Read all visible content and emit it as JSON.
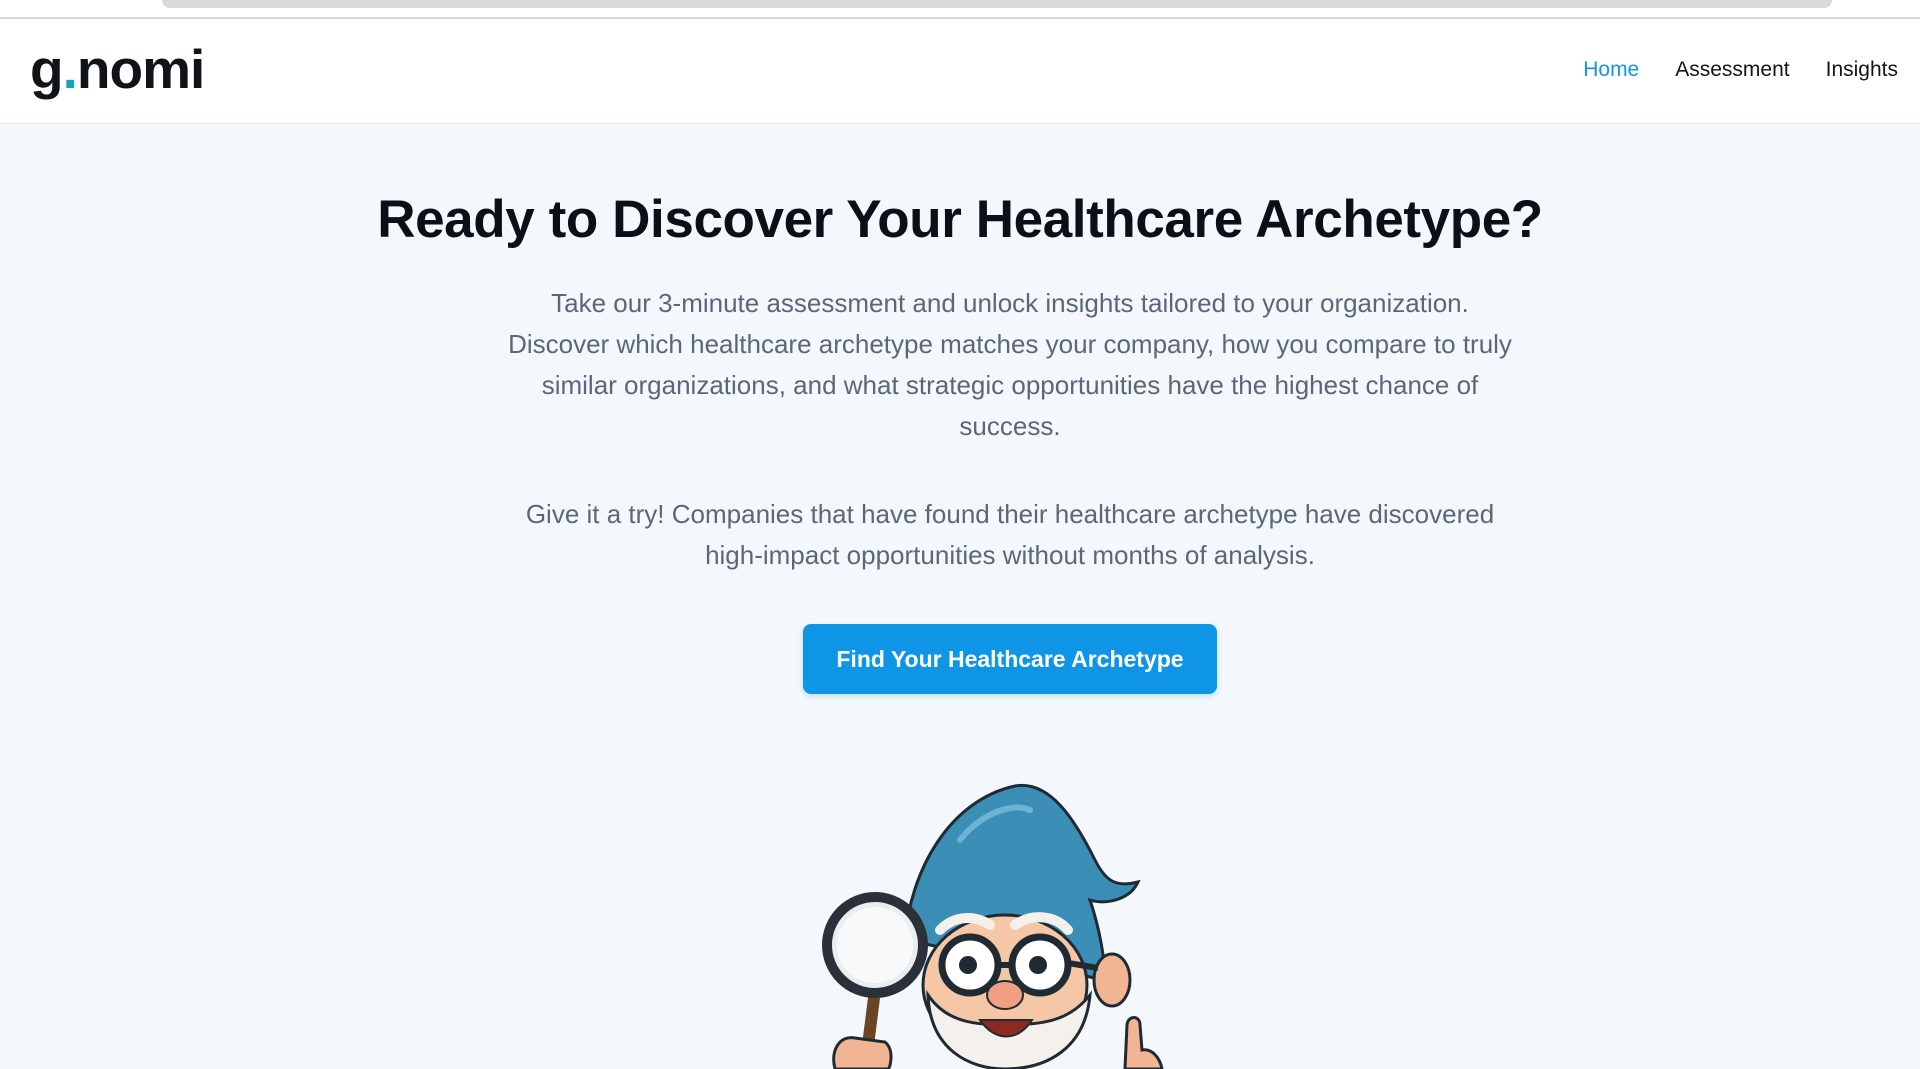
{
  "header": {
    "logo": {
      "part1": "g",
      "dot": ".",
      "part2": "nomi"
    },
    "nav": [
      {
        "label": "Home",
        "active": true
      },
      {
        "label": "Assessment",
        "active": false
      },
      {
        "label": "Insights",
        "active": false
      }
    ]
  },
  "hero": {
    "title": "Ready to Discover Your Healthcare Archetype?",
    "description": "Take our 3-minute assessment and unlock insights tailored to your organization. Discover which healthcare archetype matches your company, how you compare to truly similar organizations, and what strategic opportunities have the highest chance of success.",
    "cta_text": "Give it a try! Companies that have found their healthcare archetype have discovered high-impact opportunities without months of analysis.",
    "cta_button": "Find Your Healthcare Archetype"
  },
  "mascot": {
    "icon": "gnome-with-magnifying-glass-illustration"
  },
  "colors": {
    "accent": "#0f95e6",
    "nav_active": "#1296e0",
    "logo_dot": "#18a3b8",
    "background": "#f4f8fc",
    "heading": "#0c1016",
    "body_text": "#5b6778"
  }
}
